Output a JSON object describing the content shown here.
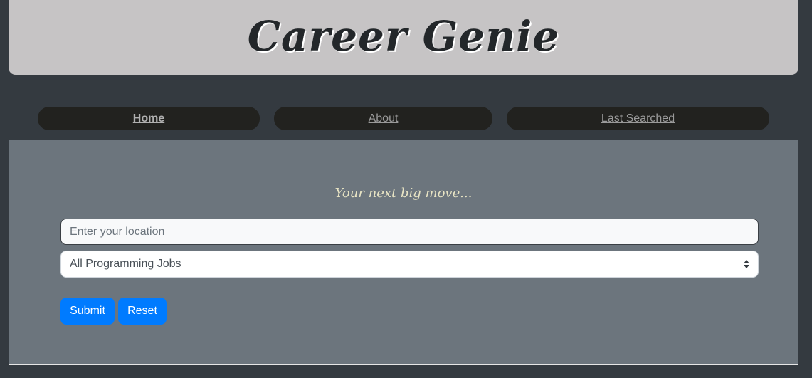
{
  "header": {
    "title": "Career Genie"
  },
  "nav": {
    "items": [
      {
        "label": "Home"
      },
      {
        "label": "About"
      },
      {
        "label": "Last Searched"
      }
    ]
  },
  "form": {
    "tagline": "Your next big move...",
    "location_placeholder": "Enter your location",
    "location_value": "",
    "job_type_selected": "All Programming Jobs",
    "submit_label": "Submit",
    "reset_label": "Reset"
  },
  "colors": {
    "page_background": "#343a40",
    "header_background": "#c6c4c5",
    "nav_background": "#22221f",
    "panel_background": "#6c757d",
    "button_primary": "#007bff"
  }
}
